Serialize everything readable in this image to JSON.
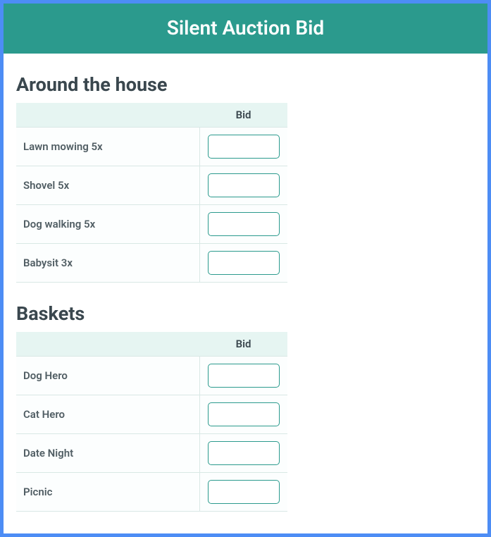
{
  "header": {
    "title": "Silent Auction Bid"
  },
  "sections": [
    {
      "title": "Around the house",
      "columns": {
        "item": "",
        "bid": "Bid"
      },
      "rows": [
        {
          "item": "Lawn mowing 5x",
          "bid": ""
        },
        {
          "item": "Shovel 5x",
          "bid": ""
        },
        {
          "item": "Dog walking 5x",
          "bid": ""
        },
        {
          "item": "Babysit 3x",
          "bid": ""
        }
      ]
    },
    {
      "title": "Baskets",
      "columns": {
        "item": "",
        "bid": "Bid"
      },
      "rows": [
        {
          "item": "Dog Hero",
          "bid": ""
        },
        {
          "item": "Cat Hero",
          "bid": ""
        },
        {
          "item": "Date Night",
          "bid": ""
        },
        {
          "item": "Picnic",
          "bid": ""
        }
      ]
    }
  ]
}
